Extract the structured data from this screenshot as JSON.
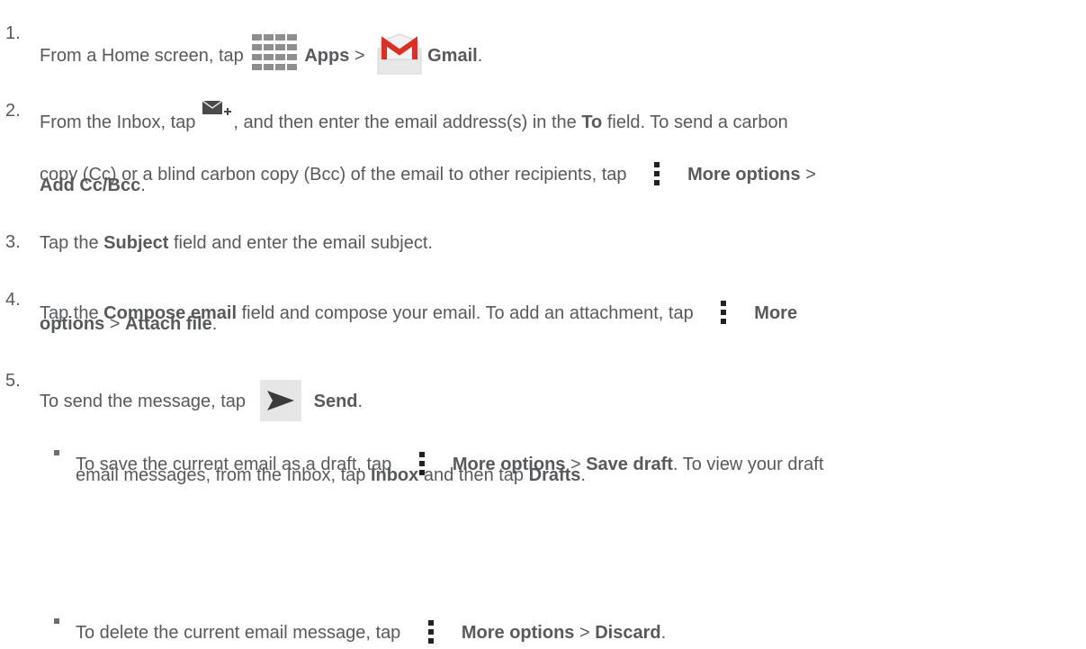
{
  "steps": {
    "s1": {
      "num": "1.",
      "pre": "From a Home screen, tap",
      "apps": "Apps",
      "sep": ">",
      "gmail": "Gmail",
      "end": "."
    },
    "s2": {
      "num": "2.",
      "pre": "From the Inbox, tap",
      "mid": ", and then enter the email address(s) in the",
      "to": "To",
      "post": "field. To send a carbon",
      "l2": "copy (Cc) or a blind carbon copy (Bcc) of the email to other recipients, tap",
      "more": "More options",
      "sep": ">",
      "addcc": "Add Cc/Bcc",
      "end": "."
    },
    "s3": {
      "num": "3.",
      "pre": "Tap the",
      "subject": "Subject",
      "post": "field and enter the email subject."
    },
    "s4": {
      "num": "4.",
      "pre": "Tap the",
      "compose": "Compose email",
      "post": "field and compose your email. To add an attachment, tap",
      "more1": "More",
      "more2": "options",
      "sep": ">",
      "attach": "Attach file",
      "end": "."
    },
    "s5": {
      "num": "5.",
      "pre": "To send the message, tap",
      "send": "Send",
      "end": "."
    }
  },
  "bullets": {
    "b1": {
      "pre": "To save the current email as a draft, tap",
      "more": "More options",
      "sep": ">",
      "save": "Save draft",
      "post": ". To view your draft",
      "l2pre": "email messages, from the Inbox, tap",
      "inbox": "Inbox",
      "l2mid": "and then tap",
      "drafts": "Drafts",
      "end": "."
    },
    "b2": {
      "pre": "To delete the current email message, tap",
      "more": "More options",
      "sep": ">",
      "discard": "Discard",
      "end": "."
    }
  },
  "icons": {
    "apps": "apps-grid-icon",
    "gmail": "gmail-icon",
    "compose": "compose-icon",
    "menu": "more-options-icon",
    "send": "send-icon"
  },
  "colors": {
    "text": "#58595b",
    "gmail_red": "#d93025",
    "icon_bg": "#e6e6e6"
  }
}
